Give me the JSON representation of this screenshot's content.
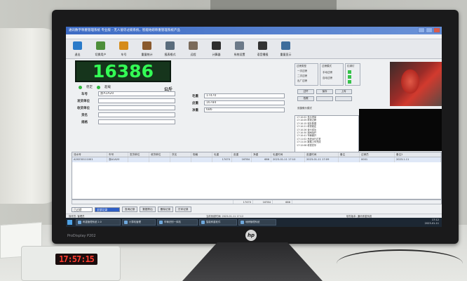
{
  "app": {
    "title": "通讯数字称重管理系统 专业版 - 无人值守过磅系统，智能地磅称重管理系统产品",
    "menu": [
      "系统维护(S)",
      "数据报表(R)",
      "称重(W)",
      "打印(P)",
      "帮助(H)"
    ]
  },
  "toolbar": [
    {
      "label": "退出",
      "icon": "exit-icon",
      "color": "#2a7ac9"
    },
    {
      "label": "切换用户",
      "icon": "user-switch-icon",
      "color": "#4e8f3a"
    },
    {
      "label": "车号",
      "icon": "car-icon",
      "color": "#d58b1a"
    },
    {
      "label": "重量统计",
      "icon": "stats-icon",
      "color": "#8a5a2e"
    },
    {
      "label": "报表格式",
      "icon": "report-icon",
      "color": "#5a6c7c"
    },
    {
      "label": "远程",
      "icon": "remote-icon",
      "color": "#7a6a5a"
    },
    {
      "label": "计算器",
      "icon": "calculator-icon",
      "color": "#2e2e2e"
    },
    {
      "label": "系统设置",
      "icon": "settings-icon",
      "color": "#6c7a89"
    },
    {
      "label": "语音播报",
      "icon": "microphone-icon",
      "color": "#333333"
    },
    {
      "label": "重量显示",
      "icon": "display-icon",
      "color": "#3e6d9c"
    }
  ],
  "display": {
    "weight": "16386",
    "unit": "公斤",
    "status": [
      "稳定",
      "超载"
    ]
  },
  "form": {
    "labels": [
      "车号",
      "发货单位",
      "收货单位",
      "货名",
      "规格"
    ],
    "values": [
      "浙A1A20",
      "",
      "",
      "",
      ""
    ],
    "weight_labels": [
      "毛重",
      "皮重",
      "净重"
    ],
    "weight_values": [
      "17470",
      "16784",
      "686"
    ]
  },
  "panels": {
    "mode_title": "过磅类型",
    "modes": [
      "一次过磅",
      "二次过磅",
      "出厂过磅"
    ],
    "mode2_title": "过磅模式",
    "mode2": [
      "手动过磅",
      "自动过磅"
    ],
    "buttons": [
      "过杆",
      "保存",
      "上传",
      "拍照"
    ],
    "light_title": "红绿灯",
    "dual_label": "双摄像头模式",
    "log": [
      "17:10:02 显示重量",
      "17:10:09 称重过磅",
      "17:10:15 保存数据",
      "17:10:21 称重稳定",
      "17:10:26 读卡成功",
      "17:10:30 道闸抬杆",
      "17:10:41 车辆离开",
      "17:11:02 系统运行正常",
      "17:11:20 数据上传完成",
      "17:12:08 称重完毕"
    ]
  },
  "table": {
    "headers": [
      "流水号",
      "车号",
      "发货单位",
      "收货单位",
      "货名",
      "规格",
      "毛重",
      "皮重",
      "净重",
      "毛重时间",
      "皮重时间",
      "备注",
      "过磅员",
      "备注2"
    ],
    "rows": [
      [
        "A20230111001",
        "浙A1A20",
        "",
        "",
        "",
        "",
        "17470",
        "16784",
        "686",
        "2023-01-11 17:10",
        "2023-01-11 17:09",
        "",
        "0001",
        "2023.1.11"
      ]
    ],
    "footer": [
      "",
      "",
      "",
      "",
      "",
      "",
      "17470",
      "16784",
      "686",
      "",
      "",
      "",
      "",
      ""
    ]
  },
  "bottom": {
    "select1": "已过磅",
    "select2": "全部记录",
    "buttons": [
      "查询记录",
      "数据导出",
      "删除记录",
      "打印记录"
    ],
    "status": [
      "操作员: 管理员",
      "当前系统时间: 2023-01-11 17:12",
      "软件版本: 通讯称重系统"
    ]
  },
  "taskbar": {
    "items": [
      "称重管理系统 2.0",
      "计算机管理",
      "车辆识别一体机",
      "智能称重软件",
      "地磅管理系统"
    ],
    "time": "17:12",
    "date": "2023-01-11"
  },
  "monitor": {
    "brand": "ProDisplay P202",
    "logo": "hp"
  },
  "desk": {
    "led_clock": "17:57:15"
  }
}
